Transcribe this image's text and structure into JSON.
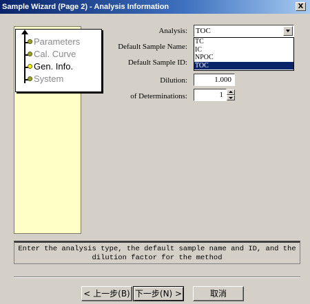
{
  "window": {
    "title": "Sample Wizard (Page 2) - Analysis Information",
    "close_label": "X"
  },
  "steps": [
    {
      "label": "Parameters",
      "active": false
    },
    {
      "label": "Cal. Curve",
      "active": false
    },
    {
      "label": "Gen. Info.",
      "active": true
    },
    {
      "label": "System",
      "active": false
    }
  ],
  "form": {
    "analysis_label": "Analysis:",
    "analysis_value": "TOC",
    "analysis_options": [
      "TC",
      "IC",
      "NPOC",
      "TOC"
    ],
    "analysis_selected": "TOC",
    "sample_name_label": "Default Sample Name:",
    "sample_id_label": "Default Sample ID:",
    "dilution_label": "Dilution:",
    "dilution_value": "1.000",
    "determinations_label": "of Determinations:",
    "determinations_value": "1"
  },
  "hint": {
    "line1": "Enter the analysis type, the default sample name and ID, and the",
    "line2": "dilution factor for the method"
  },
  "buttons": {
    "back": "< 上一步(B)",
    "next": "下一步(N) >",
    "cancel": "取消"
  }
}
